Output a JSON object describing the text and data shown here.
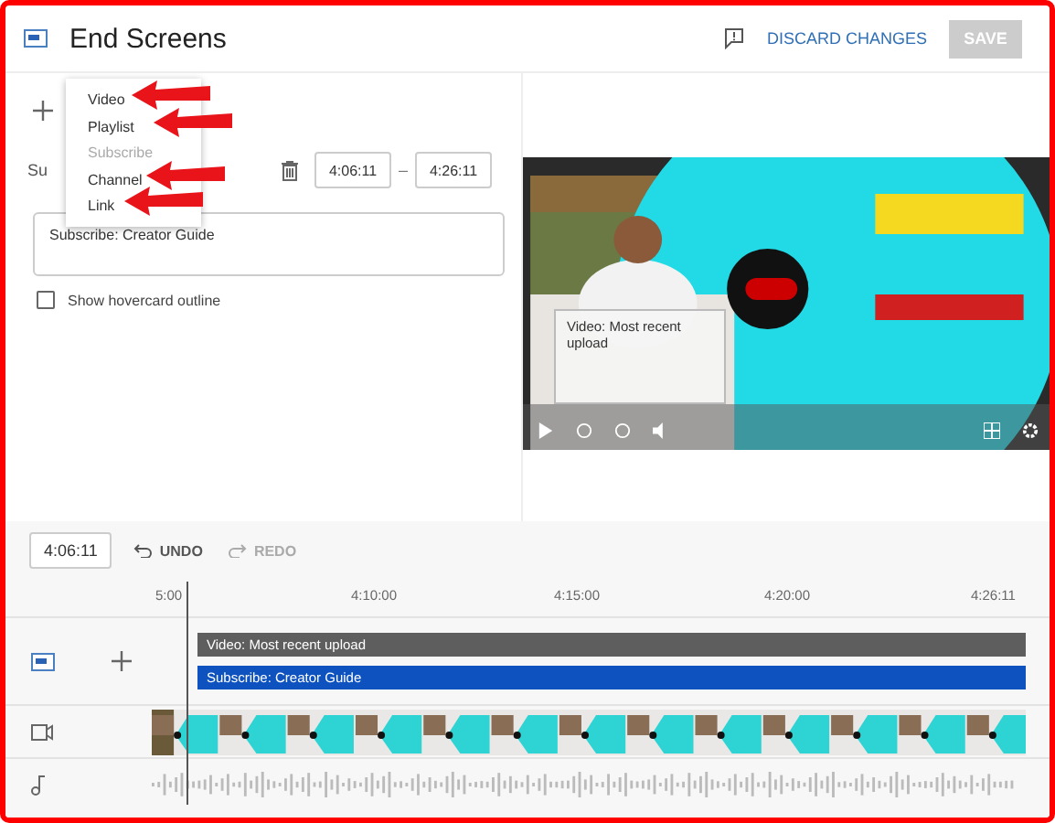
{
  "window": {
    "title": "End Screens"
  },
  "header_actions": {
    "discard": "DISCARD CHANGES",
    "save": {
      "label": "SAVE",
      "disabled": true
    }
  },
  "add_menu": {
    "items": [
      {
        "label": "Video",
        "disabled": false,
        "annotated": true
      },
      {
        "label": "Playlist",
        "disabled": false,
        "annotated": true
      },
      {
        "label": "Subscribe",
        "disabled": true,
        "annotated": false
      },
      {
        "label": "Channel",
        "disabled": false,
        "annotated": true
      },
      {
        "label": "Link",
        "disabled": false,
        "annotated": true
      }
    ]
  },
  "element": {
    "label": "Su",
    "start": "4:06:11",
    "separator": "–",
    "end": "4:26:11",
    "value": "Subscribe: Creator Guide"
  },
  "hovercard": {
    "label": "Show hovercard outline",
    "checked": false
  },
  "preview": {
    "overlay": "Video: Most recent upload"
  },
  "timeline": {
    "time": "4:06:11",
    "undo": {
      "label": "UNDO",
      "disabled": false
    },
    "redo": {
      "label": "REDO",
      "disabled": true
    },
    "ticks": [
      "5:00",
      "4:10:00",
      "4:15:00",
      "4:20:00",
      "4:26:11"
    ],
    "tracks": [
      {
        "kind": "video",
        "label": "Video: Most recent upload"
      },
      {
        "kind": "subscribe",
        "label": "Subscribe: Creator Guide"
      }
    ]
  }
}
